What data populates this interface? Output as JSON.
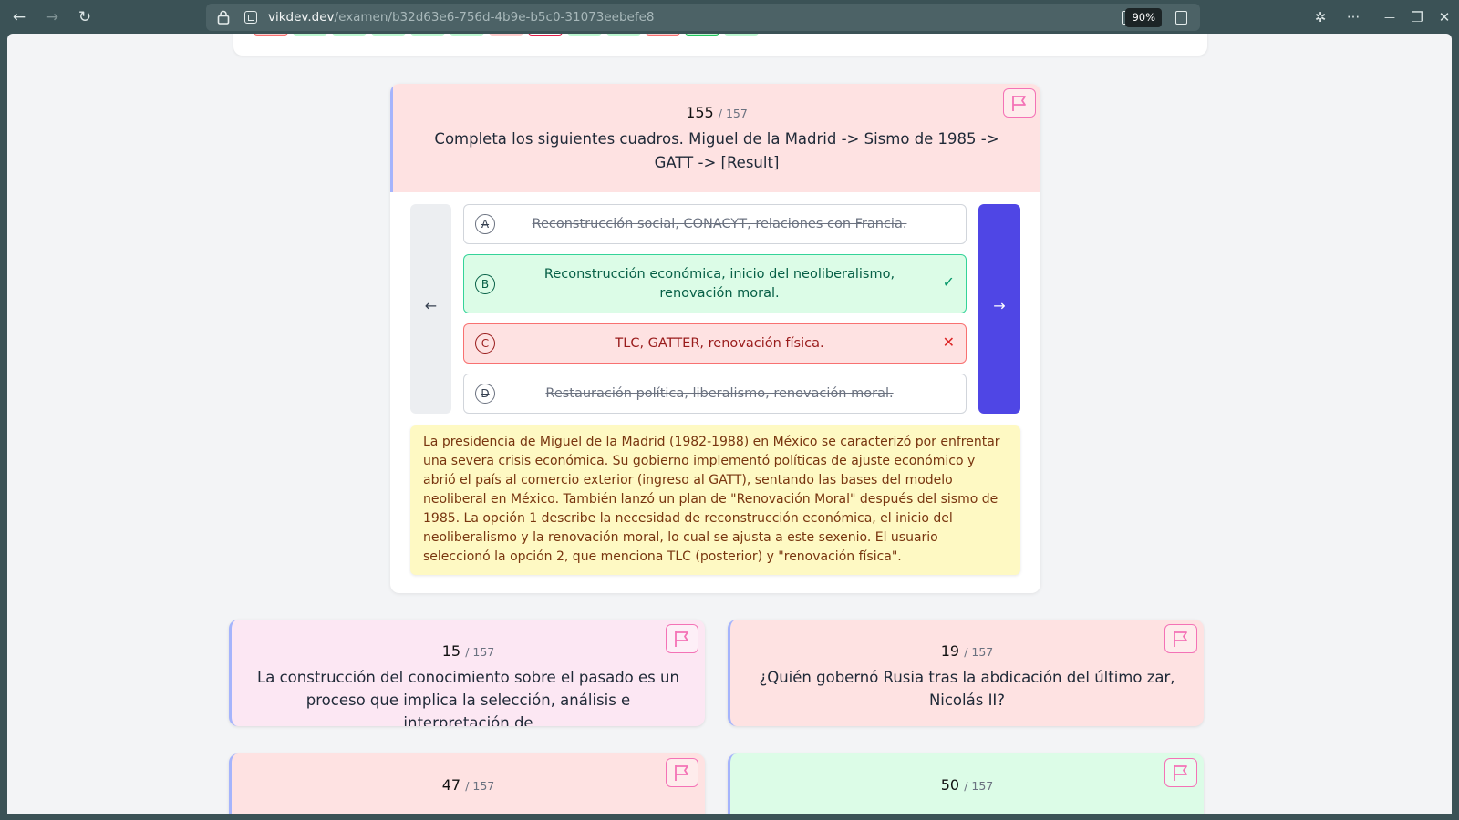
{
  "browser": {
    "url_host": "vikdev.dev",
    "url_path": "/examen/b32d63e6-756d-4b9e-b5c0-31073eebefe8",
    "zoom": "90%",
    "back_icon": "←",
    "forward_icon": "→",
    "reload_icon": "↻",
    "extensions_icon": "✲",
    "more_icon": "···",
    "minimize_icon": "—",
    "restore_icon": "❐",
    "close_icon": "✕"
  },
  "question_nav": {
    "pills": [
      "red",
      "green",
      "green",
      "green",
      "green",
      "green",
      "red-soft",
      "white-red",
      "green",
      "green",
      "red",
      "green-border",
      "green"
    ]
  },
  "current_question": {
    "number": "155",
    "total": "/ 157",
    "text": "Completa los siguientes cuadros. Miguel de la Madrid -> Sismo de 1985 -> GATT -> [Result]",
    "prev_icon": "←",
    "next_icon": "→",
    "options": [
      {
        "letter": "A",
        "text": "Reconstrucción social, CONACYT, relaciones con Francia.",
        "state": "struck",
        "mark": ""
      },
      {
        "letter": "B",
        "text": "Reconstrucción económica, inicio del neoliberalismo, renovación moral.",
        "state": "correct",
        "mark": "✓"
      },
      {
        "letter": "C",
        "text": "TLC, GATTER, renovación física.",
        "state": "wrong",
        "mark": "✕"
      },
      {
        "letter": "D",
        "text": "Restauración política, liberalismo, renovación moral.",
        "state": "struck",
        "mark": ""
      }
    ],
    "explanation": "La presidencia de Miguel de la Madrid (1982-1988) en México se caracterizó por enfrentar una severa crisis económica. Su gobierno implementó políticas de ajuste económico y abrió el país al comercio exterior (ingreso al GATT), sentando las bases del modelo neoliberal en México. También lanzó un plan de \"Renovación Moral\" después del sismo de 1985. La opción 1 describe la necesidad de reconstrucción económica, el inicio del neoliberalismo y la renovación moral, lo cual se ajusta a este sexenio. El usuario seleccionó la opción 2, que menciona TLC (posterior) y \"renovación física\"."
  },
  "other_questions": [
    {
      "number": "15",
      "total": "/ 157",
      "text": "La construcción del conocimiento sobre el pasado es un proceso que implica la selección, análisis e interpretación de",
      "status": "pink"
    },
    {
      "number": "19",
      "total": "/ 157",
      "text": "¿Quién gobernó Rusia tras la abdicación del último zar, Nicolás II?",
      "status": "red"
    },
    {
      "number": "47",
      "total": "/ 157",
      "text": "",
      "status": "red"
    },
    {
      "number": "50",
      "total": "/ 157",
      "text": "",
      "status": "green"
    }
  ],
  "colors": {
    "accent": "#4f46e5",
    "correct": "#dcfce7",
    "wrong": "#fee2e2",
    "explanation": "#fef9c3",
    "flag": "#f472b6"
  }
}
